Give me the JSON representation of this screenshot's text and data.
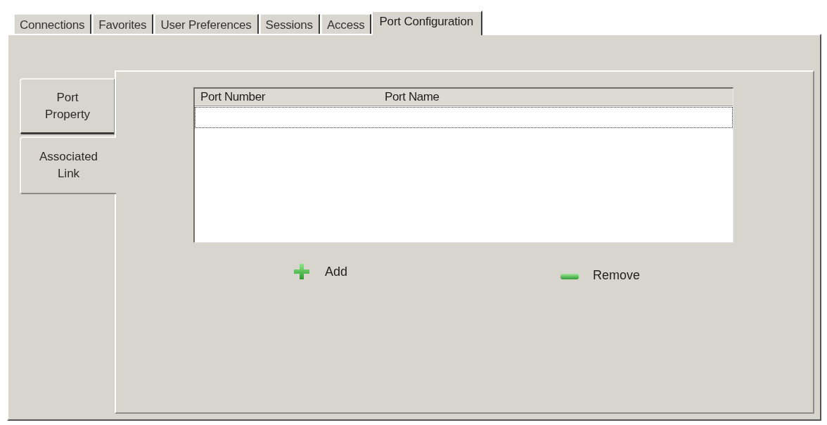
{
  "tabs": [
    {
      "label": "Connections",
      "selected": false
    },
    {
      "label": "Favorites",
      "selected": false
    },
    {
      "label": "User Preferences",
      "selected": false
    },
    {
      "label": "Sessions",
      "selected": false
    },
    {
      "label": "Access",
      "selected": false
    },
    {
      "label": "Port Configuration",
      "selected": true
    }
  ],
  "side_tabs": [
    {
      "label": "Port Property",
      "selected": false
    },
    {
      "label": "Associated Link",
      "selected": true
    }
  ],
  "table": {
    "columns": [
      "Port Number",
      "Port Name"
    ]
  },
  "buttons": [
    {
      "label": "Add",
      "kind": "add"
    },
    {
      "label": "Remove",
      "kind": "remove"
    }
  ]
}
